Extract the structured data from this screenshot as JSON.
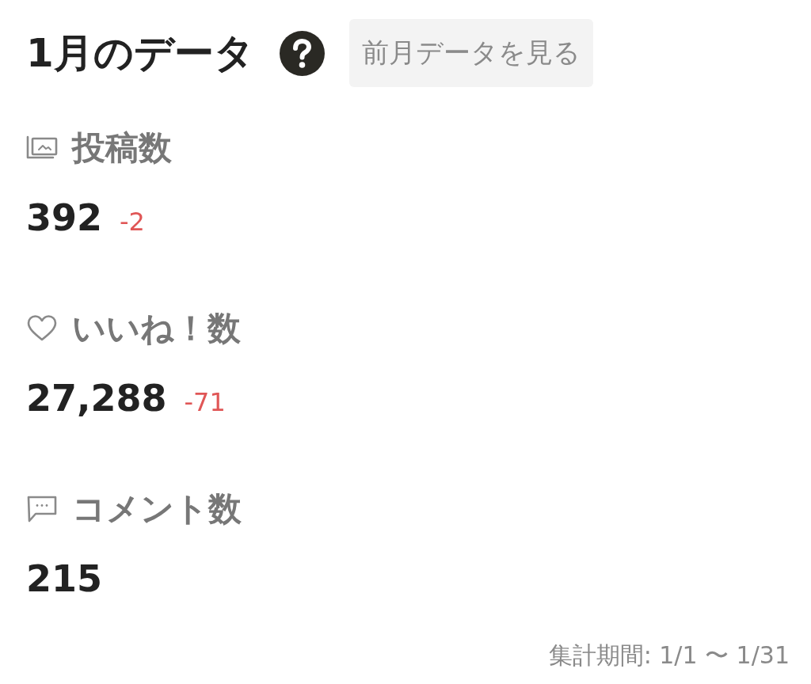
{
  "header": {
    "title": "1月のデータ",
    "button": "前月データを見る"
  },
  "metrics": [
    {
      "kind": "posts",
      "label": "投稿数",
      "value": "392",
      "delta": "-2"
    },
    {
      "kind": "likes",
      "label": "いいね！数",
      "value": "27,288",
      "delta": "-71"
    },
    {
      "kind": "comments",
      "label": "コメント数",
      "value": "215"
    }
  ],
  "period": "集計期間: 1/1 〜 1/31"
}
